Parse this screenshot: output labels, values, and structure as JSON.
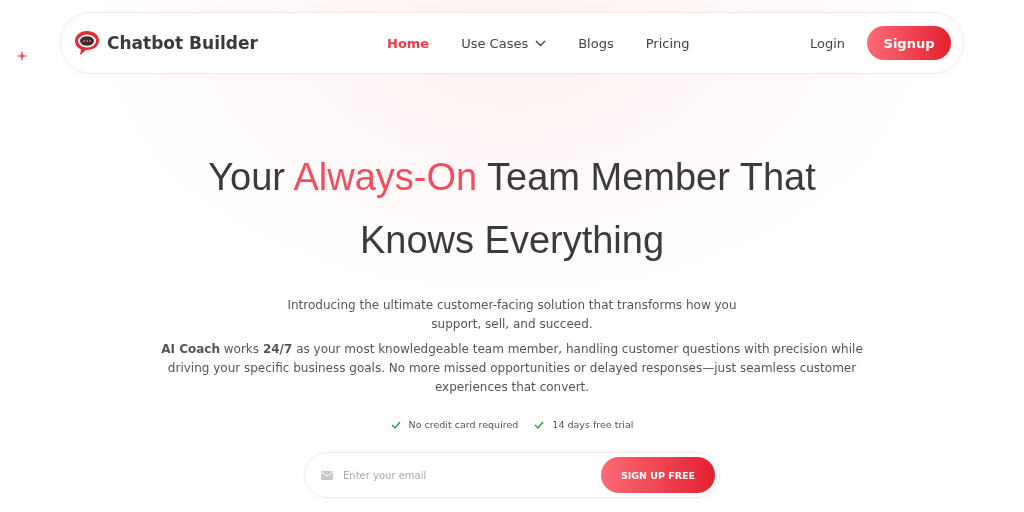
{
  "brand": {
    "name": "Chatbot Builder"
  },
  "nav": [
    {
      "label": "Home",
      "selected": true,
      "dropdown": false
    },
    {
      "label": "Use Cases",
      "selected": false,
      "dropdown": true
    },
    {
      "label": "Blogs",
      "selected": false,
      "dropdown": false
    },
    {
      "label": "Pricing",
      "selected": false,
      "dropdown": false
    }
  ],
  "login": "Login",
  "signup": "Signup",
  "headline": [
    {
      "text": "Your ",
      "accent": false
    },
    {
      "text": "Always-On",
      "accent": true
    },
    {
      "text": " Team Member That Knows Everything",
      "accent": false
    }
  ],
  "intro": "Introducing the ultimate customer-facing solution that transforms how you support, sell, and succeed.",
  "description": "**AI Coach** works **24/7** as your most knowledgeable team member, handling customer questions with precision while driving your specific business goals. No more missed opportunities or delayed responses—just seamless customer experiences that convert.",
  "perks": [
    "No credit card required",
    "14 days free trial"
  ],
  "email": {
    "placeholder": "Enter your email"
  },
  "cta": "SIGN UP FREE"
}
